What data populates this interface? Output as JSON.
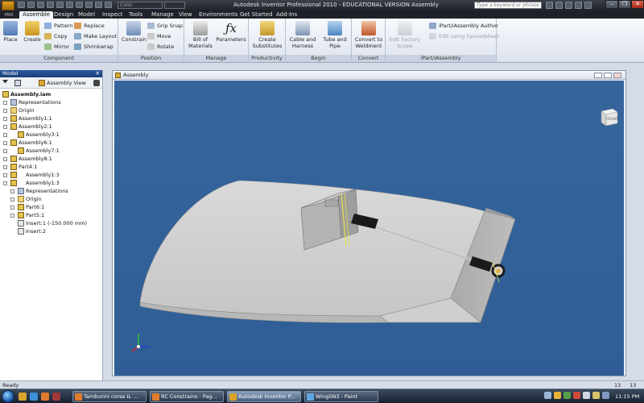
{
  "title_bar": {
    "app_title": "Autodesk Inventor Professional 2010 - EDUCATIONAL VERSION    Assembly",
    "color_combo_value": "Color",
    "search_placeholder": "Type a keyword or phrase",
    "window_buttons": {
      "minimize": "–",
      "restore": "❐",
      "close": "✕"
    }
  },
  "ribbon": {
    "badge": "PRO",
    "tabs": [
      "Assemble",
      "Design",
      "Model",
      "Inspect",
      "Tools",
      "Manage",
      "View",
      "Environments",
      "Get Started",
      "Add-Ins"
    ],
    "component_panel": {
      "label": "Component",
      "place": "Place",
      "create": "Create",
      "pattern": "Pattern",
      "copy": "Copy",
      "mirror": "Mirror",
      "replace": "Replace",
      "make_layout": "Make Layout",
      "shrinkwrap": "Shrinkwrap"
    },
    "position_panel": {
      "label": "Position",
      "constrain": "Constrain",
      "grip_snap": "Grip Snap",
      "move": "Move",
      "rotate": "Rotate"
    },
    "manage_panel": {
      "label": "Manage",
      "bill_of_materials_1": "Bill of",
      "bill_of_materials_2": "Materials",
      "parameters": "Parameters"
    },
    "productivity_panel": {
      "label": "Productivity",
      "create_substitutes_1": "Create",
      "create_substitutes_2": "Substitutes"
    },
    "begin_panel": {
      "label": "Begin",
      "cable_harness_1": "Cable and",
      "cable_harness_2": "Harness",
      "tube_pipe_1": "Tube and",
      "tube_pipe_2": "Pipe"
    },
    "convert_panel": {
      "label": "Convert",
      "convert_weldment_1": "Convert to",
      "convert_weldment_2": "Weldment"
    },
    "scope_panel": {
      "edit_factory_1": "Edit Factory",
      "edit_factory_2": "Scope"
    },
    "ipart_panel": {
      "label": "iPart/iAssembly",
      "author": "iPart/iAssembly Author",
      "edit_spreadsheet": "Edit using Spreadsheet"
    }
  },
  "browser": {
    "title": "Model",
    "close": "✕",
    "view_mode": "Assembly View",
    "items": [
      {
        "label": "Assembly.iam",
        "icon": "assembly-icon"
      },
      {
        "label": "Representations",
        "icon": "representations-icon"
      },
      {
        "label": "Origin",
        "icon": "folder-icon"
      },
      {
        "label": "Assembly1:1",
        "icon": "assembly-icon"
      },
      {
        "label": "Assembly2:1",
        "icon": "assembly-icon"
      },
      {
        "label": "Assembly3:1",
        "icon": "assembly-icon"
      },
      {
        "label": "Assembly6:1",
        "icon": "assembly-icon"
      },
      {
        "label": "Assembly7:1",
        "icon": "assembly-icon"
      },
      {
        "label": "Assembly8:1",
        "icon": "assembly-icon"
      },
      {
        "label": "Part4:1",
        "icon": "part-icon"
      },
      {
        "label": "Assembly1:3",
        "icon": "assembly-icon"
      },
      {
        "label": "Assembly1:3",
        "icon": "assembly-icon"
      },
      {
        "label": "Representations",
        "icon": "representations-icon"
      },
      {
        "label": "Origin",
        "icon": "folder-icon"
      },
      {
        "label": "Part6:1",
        "icon": "part-icon"
      },
      {
        "label": "Part5:1",
        "icon": "part-icon"
      },
      {
        "label": "Insert:1 (-150.000 mm)",
        "icon": "insert-constraint-icon"
      },
      {
        "label": "Insert:2",
        "icon": "insert-constraint-icon"
      }
    ]
  },
  "document": {
    "title": "Assembly",
    "viewcube_face": "FRONT"
  },
  "status_bar": {
    "text": "Ready",
    "count1": "13",
    "count2": "13"
  },
  "taskbar": {
    "tasks": [
      {
        "label": "Tamburini corse IL ..."
      },
      {
        "label": "RC Constrains - Pag..."
      },
      {
        "label": "Autodesk Inventor P..."
      },
      {
        "label": "WingSN3 - Paint"
      }
    ],
    "clock": "11:15 PM"
  },
  "colors": {
    "viewport_background": "#2f5e96",
    "ribbon_background": "#e6ebf3",
    "title_bar": "#2a2e36",
    "browser_header": "#1f4587"
  }
}
